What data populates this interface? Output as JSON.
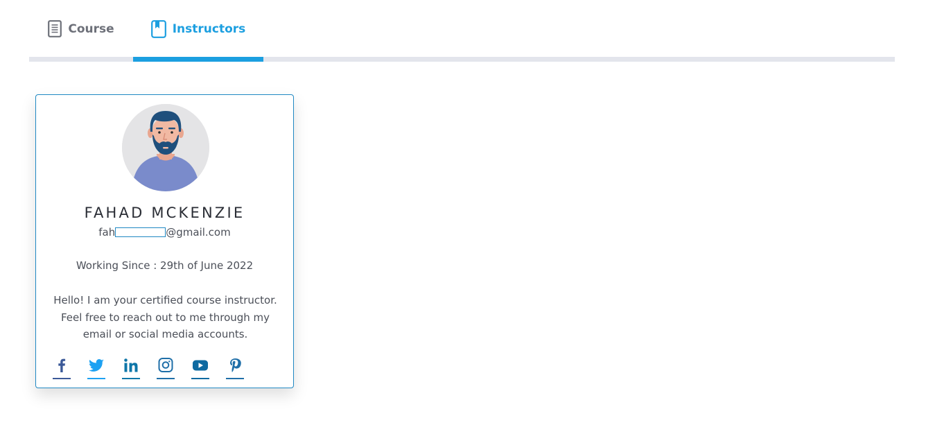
{
  "tabs": [
    {
      "label": "Course",
      "icon": "document-icon",
      "active": false
    },
    {
      "label": "Instructors",
      "icon": "bookmark-book-icon",
      "active": true
    }
  ],
  "colors": {
    "accent": "#1c9fe0",
    "card_border": "#1f88c3",
    "track": "#e3e5ec",
    "facebook": "#3b5998",
    "twitter": "#1da1f2",
    "linkedin": "#0e76a8",
    "instagram": "#1f6fa8",
    "youtube": "#0e6aa1",
    "pinterest": "#1f6fa8"
  },
  "instructor": {
    "name": "FAHAD MCKENZIE",
    "email_prefix": "fah",
    "email_suffix": "@gmail.com",
    "working_since": "Working Since : 29th of June 2022",
    "bio": "Hello! I am your certified course instructor. Feel free to reach out to me through my email or social media accounts.",
    "socials": [
      "facebook-icon",
      "twitter-icon",
      "linkedin-icon",
      "instagram-icon",
      "youtube-icon",
      "pinterest-icon"
    ]
  }
}
